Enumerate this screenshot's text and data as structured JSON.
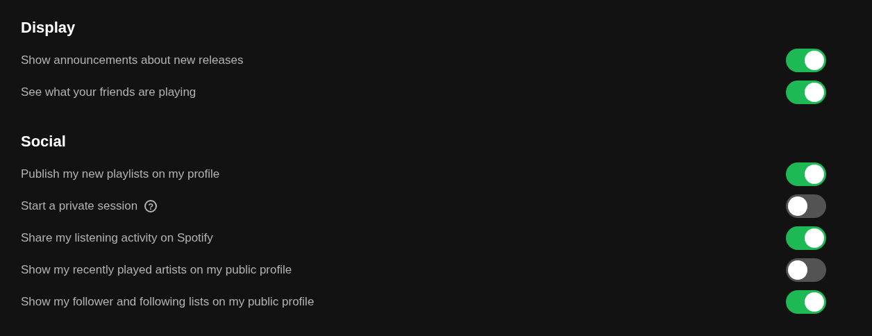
{
  "sections": [
    {
      "title": "Display",
      "settings": [
        {
          "label": "Show announcements about new releases",
          "on": true
        },
        {
          "label": "See what your friends are playing",
          "on": true
        }
      ]
    },
    {
      "title": "Social",
      "settings": [
        {
          "label": "Publish my new playlists on my profile",
          "on": true
        },
        {
          "label": "Start a private session",
          "on": false,
          "help": "?"
        },
        {
          "label": "Share my listening activity on Spotify",
          "on": true
        },
        {
          "label": "Show my recently played artists on my public profile",
          "on": false
        },
        {
          "label": "Show my follower and following lists on my public profile",
          "on": true
        }
      ]
    }
  ]
}
